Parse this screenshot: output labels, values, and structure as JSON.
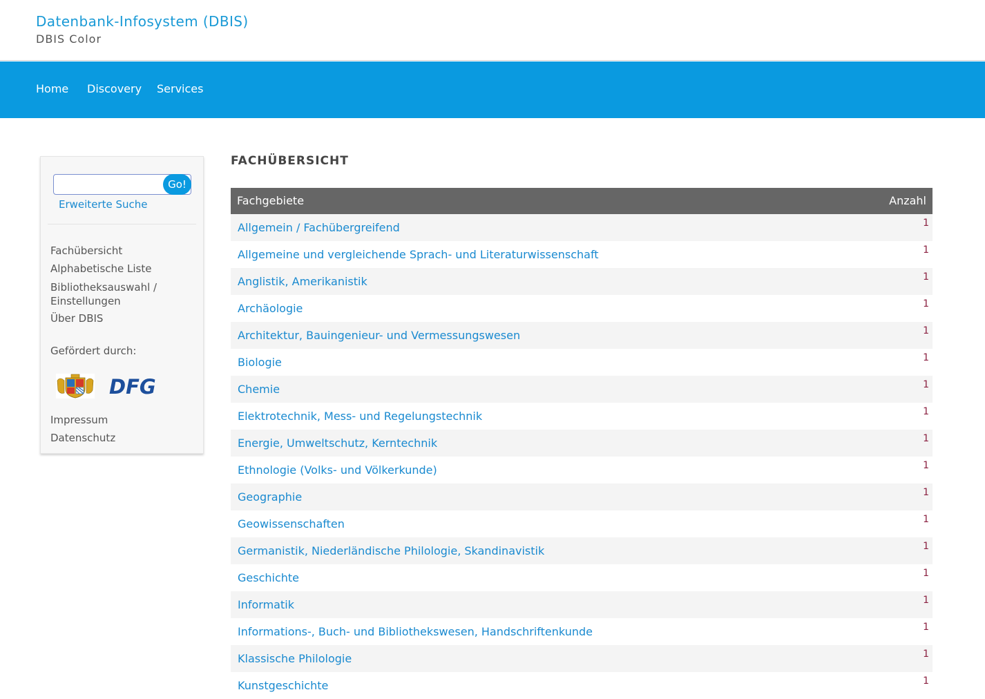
{
  "header": {
    "title": "Datenbank-Infosystem (DBIS)",
    "subtitle": "DBIS Color"
  },
  "nav": {
    "items": [
      {
        "label": "Home"
      },
      {
        "label": "Discovery"
      },
      {
        "label": "Services"
      }
    ]
  },
  "sidebar": {
    "search": {
      "value": "",
      "button_label": "Go!"
    },
    "advanced_search": "Erweiterte Suche",
    "links": [
      {
        "label": "Fachübersicht"
      },
      {
        "label": "Alphabetische Liste"
      },
      {
        "label": "Bibliotheksauswahl /\nEinstellungen"
      },
      {
        "label": "Über DBIS"
      }
    ],
    "funded_by": "Gefördert durch:",
    "logos": [
      {
        "name": "bavaria-coat-of-arms",
        "text": ""
      },
      {
        "name": "dfg-logo",
        "text": "DFG"
      }
    ],
    "footer_links": [
      {
        "label": "Impressum"
      },
      {
        "label": "Datenschutz"
      }
    ]
  },
  "main": {
    "heading": "FACHÜBERSICHT",
    "table": {
      "columns": [
        "Fachgebiete",
        "Anzahl"
      ],
      "rows": [
        {
          "subject": "Allgemein / Fachübergreifend",
          "count": "1"
        },
        {
          "subject": "Allgemeine und vergleichende Sprach- und Literaturwissenschaft",
          "count": "1"
        },
        {
          "subject": "Anglistik, Amerikanistik",
          "count": "1"
        },
        {
          "subject": "Archäologie",
          "count": "1"
        },
        {
          "subject": "Architektur, Bauingenieur- und Vermessungswesen",
          "count": "1"
        },
        {
          "subject": "Biologie",
          "count": "1"
        },
        {
          "subject": "Chemie",
          "count": "1"
        },
        {
          "subject": "Elektrotechnik, Mess- und Regelungstechnik",
          "count": "1"
        },
        {
          "subject": "Energie, Umweltschutz, Kerntechnik",
          "count": "1"
        },
        {
          "subject": "Ethnologie (Volks- und Völkerkunde)",
          "count": "1"
        },
        {
          "subject": "Geographie",
          "count": "1"
        },
        {
          "subject": "Geowissenschaften",
          "count": "1"
        },
        {
          "subject": "Germanistik, Niederländische Philologie, Skandinavistik",
          "count": "1"
        },
        {
          "subject": "Geschichte",
          "count": "1"
        },
        {
          "subject": "Informatik",
          "count": "1"
        },
        {
          "subject": "Informations-, Buch- und Bibliothekswesen, Handschriftenkunde",
          "count": "1"
        },
        {
          "subject": "Klassische Philologie",
          "count": "1"
        },
        {
          "subject": "Kunstgeschichte",
          "count": "1"
        }
      ]
    }
  },
  "colors": {
    "brand_blue": "#0a9ae0",
    "link_blue": "#1a8ad0",
    "table_header": "#666666",
    "count_color": "#8a2040",
    "dfg_blue": "#1d4f9c"
  }
}
